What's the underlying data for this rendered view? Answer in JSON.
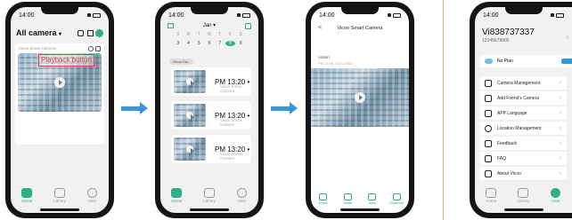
{
  "status_time": "14:00",
  "tabs": {
    "home": "Home",
    "library": "Library",
    "user": "User"
  },
  "screen1": {
    "title": "All camera",
    "title_caret": "▾",
    "camera_name": "Vicoo Smart Camera",
    "annotation": "Playback button"
  },
  "screen2": {
    "month": "Jan",
    "weekdays": [
      "S",
      "M",
      "T",
      "W",
      "T",
      "F",
      "S"
    ],
    "days": [
      "3",
      "4",
      "5",
      "6",
      "7",
      "8",
      "9"
    ],
    "selected_day": "8",
    "filter": "Vicoo Sm..",
    "events": [
      {
        "period": "PM",
        "time": "13:20",
        "camera": "Vicoo Smart Camera"
      },
      {
        "period": "PM",
        "time": "13:20",
        "camera": "Vicoo Smart Camera"
      },
      {
        "period": "PM",
        "time": "13:20",
        "camera": "Vicoo Smart Camera"
      }
    ]
  },
  "screen3": {
    "back": "<",
    "title": "Vicoo Smart Camera",
    "user": "Admin",
    "timestamp": "PM 14:00, 01/01/2020",
    "actions": [
      "Delete",
      "Share",
      "Mark",
      "Download"
    ]
  },
  "screen4": {
    "user_id": "Vi838737337",
    "phone": "12345678900",
    "plan": "No Plan",
    "menu": [
      "Camera Management",
      "Add Friend's Camera",
      "APP Language",
      "Location Management",
      "Feedback",
      "FAQ",
      "About Vicoo"
    ]
  },
  "colors": {
    "accent": "#2fae8a",
    "arrow": "#3b95d6",
    "annotation": "#e0403a"
  }
}
